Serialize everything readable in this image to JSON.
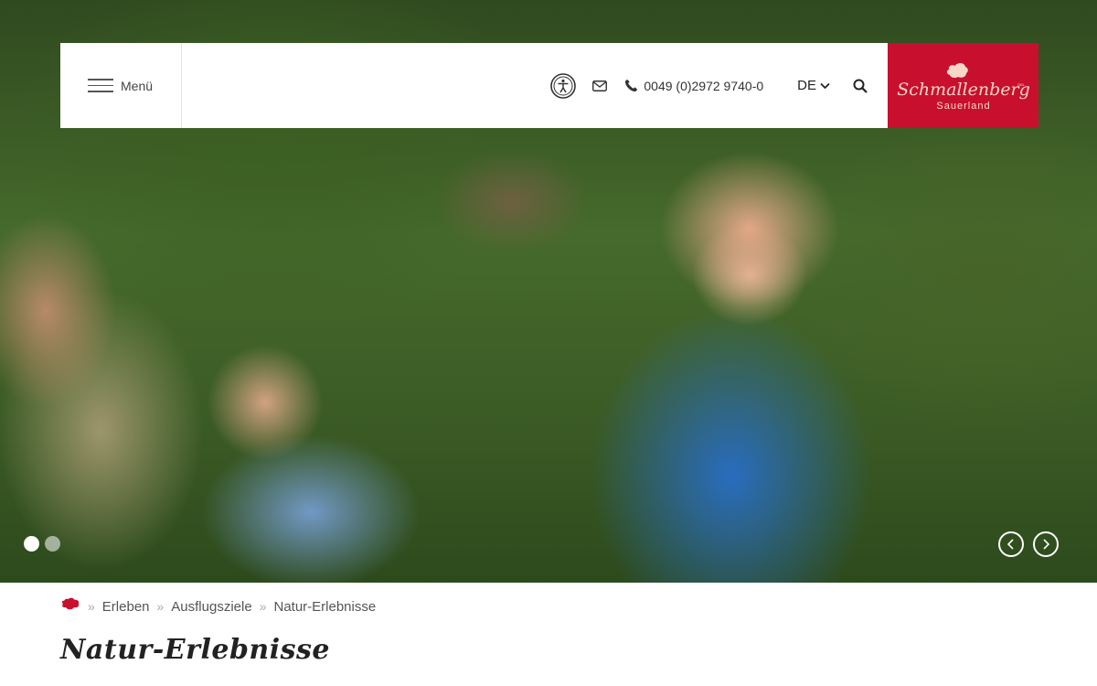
{
  "header": {
    "menu_label": "Menü",
    "phone": "0049 (0)2972 9740-0",
    "language": "DE",
    "icons": {
      "menu": "hamburger-icon",
      "accessibility": "accessibility-icon",
      "mail": "mail-icon",
      "phone": "phone-icon",
      "language_dropdown": "chevron-down-icon",
      "search": "search-icon"
    }
  },
  "logo": {
    "line1": "Schmallenberg",
    "line2": "Sauerland",
    "trademark": "GBL",
    "color": "#c8102e"
  },
  "hero": {
    "slides_count": 2,
    "active_slide": 1,
    "prev_icon": "chevron-left-icon",
    "next_icon": "chevron-right-icon"
  },
  "breadcrumb": {
    "home_icon": "home-map-icon",
    "separator": "»",
    "items": [
      "Erleben",
      "Ausflugsziele",
      "Natur-Erlebnisse"
    ]
  },
  "page": {
    "title": "Natur-Erlebnisse"
  }
}
